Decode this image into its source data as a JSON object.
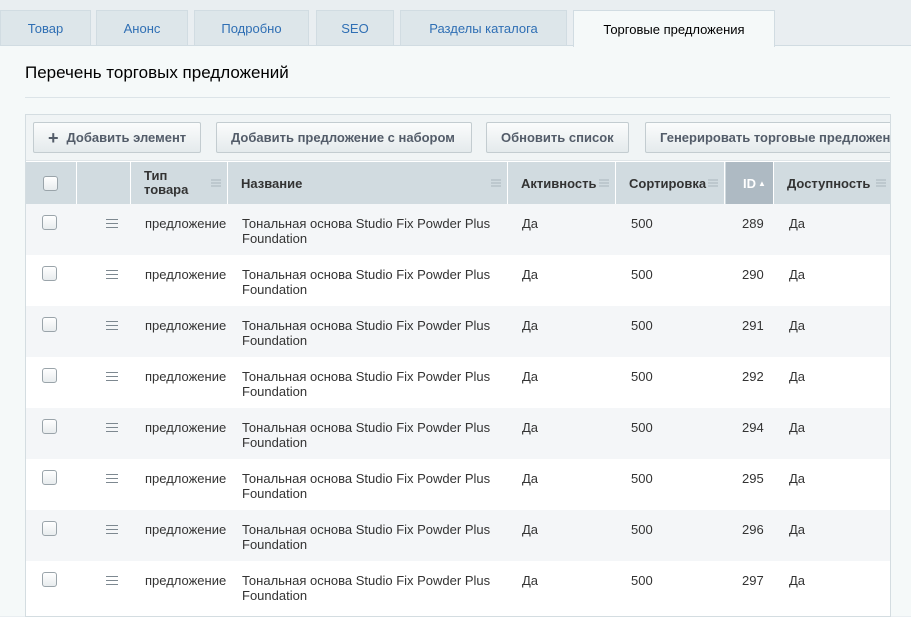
{
  "tabs": [
    {
      "label": "Товар",
      "active": false
    },
    {
      "label": "Анонс",
      "active": false
    },
    {
      "label": "Подробно",
      "active": false
    },
    {
      "label": "SEO",
      "active": false
    },
    {
      "label": "Разделы каталога",
      "active": false
    },
    {
      "label": "Торговые предложения",
      "active": true
    }
  ],
  "section": {
    "title": "Перечень торговых предложений"
  },
  "toolbar": {
    "add_element": "Добавить элемент",
    "add_offer_set": "Добавить предложение с набором",
    "refresh_list": "Обновить список",
    "generate_offers": "Генерировать торговые предложения"
  },
  "columns": {
    "type": "Тип товара",
    "name": "Название",
    "active": "Активность",
    "sort": "Сортировка",
    "id": "ID",
    "availability": "Доступность"
  },
  "sorted_column": "ID",
  "sort_direction": "ascending",
  "rows": [
    {
      "type": "предложение",
      "name": "Тональная основа Studio Fix Powder Plus Foundation",
      "active": "Да",
      "sort": "500",
      "id": "289",
      "availability": "Да"
    },
    {
      "type": "предложение",
      "name": "Тональная основа Studio Fix Powder Plus Foundation",
      "active": "Да",
      "sort": "500",
      "id": "290",
      "availability": "Да"
    },
    {
      "type": "предложение",
      "name": "Тональная основа Studio Fix Powder Plus Foundation",
      "active": "Да",
      "sort": "500",
      "id": "291",
      "availability": "Да"
    },
    {
      "type": "предложение",
      "name": "Тональная основа Studio Fix Powder Plus Foundation",
      "active": "Да",
      "sort": "500",
      "id": "292",
      "availability": "Да"
    },
    {
      "type": "предложение",
      "name": "Тональная основа Studio Fix Powder Plus Foundation",
      "active": "Да",
      "sort": "500",
      "id": "294",
      "availability": "Да"
    },
    {
      "type": "предложение",
      "name": "Тональная основа Studio Fix Powder Plus Foundation",
      "active": "Да",
      "sort": "500",
      "id": "295",
      "availability": "Да"
    },
    {
      "type": "предложение",
      "name": "Тональная основа Studio Fix Powder Plus Foundation",
      "active": "Да",
      "sort": "500",
      "id": "296",
      "availability": "Да"
    },
    {
      "type": "предложение",
      "name": "Тональная основа Studio Fix Powder Plus Foundation",
      "active": "Да",
      "sort": "500",
      "id": "297",
      "availability": "Да"
    }
  ],
  "colors": {
    "link": "#2f6fb4",
    "header_bg": "#d1dbe0",
    "sorted_header_bg": "#aebac3"
  }
}
